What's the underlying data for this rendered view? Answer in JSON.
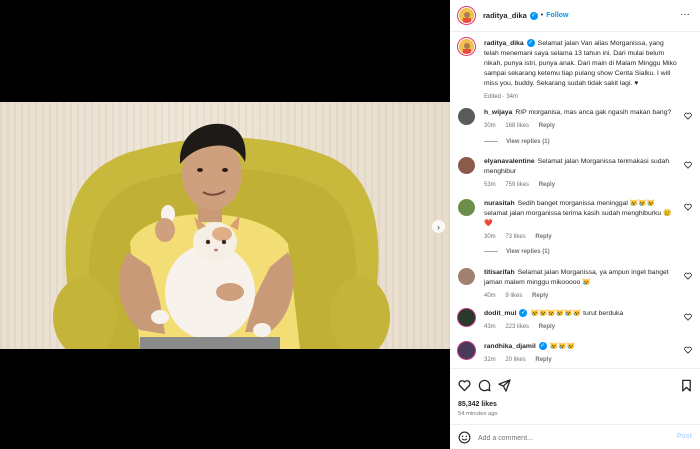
{
  "post": {
    "username": "raditya_dika",
    "follow_label": "Follow",
    "more_label": "···",
    "caption_text": "Selamat jalan Van alias Morganissa, yang telah menemani saya selama 13 tahun ini. Dari mulai belum nikah, punya istri, punya anak. Dari main di Malam Minggu Miko sampai sekarang ketemu tiap pulang show Cerita Sialku. I will miss you, buddy. Sekarang sudah tidak sakit lagi. ♥",
    "caption_edited": "Edited · 34m"
  },
  "comments": [
    {
      "user": "h_wijaya",
      "text": "RIP morganisa, mas anca gak ngasih makan bang?",
      "time": "30m",
      "likes": "168 likes",
      "reply": "Reply",
      "view_replies": "View replies (1)",
      "avatar_color": "#5a5a5a"
    },
    {
      "user": "elyanavalentine",
      "text": "Selamat jalan Morganissa terimakasi sudah menghibur",
      "time": "53m",
      "likes": "759 likes",
      "reply": "Reply",
      "avatar_color": "#8a5a4a"
    },
    {
      "user": "nurasitah",
      "text": "Sedih banget morganissa meninggal 😿😿😿 selamat jalan morganissa terima kasih sudah menghiburku 😢❤️",
      "time": "30m",
      "likes": "73 likes",
      "reply": "Reply",
      "view_replies": "View replies (1)",
      "avatar_color": "#6b8f4a"
    },
    {
      "user": "titisarifah",
      "text": "Selamat jalan Morganissa, ya ampun inget banget jaman malem minggu mikooooo 😿",
      "time": "40m",
      "likes": "9 likes",
      "reply": "Reply",
      "avatar_color": "#a08070"
    },
    {
      "user": "dodit_mul",
      "text": "😿😿😿😿😿😿 turut berduka",
      "time": "43m",
      "likes": "223 likes",
      "reply": "Reply",
      "avatar_color": "#2b3a2b",
      "verified": true
    },
    {
      "user": "randhika_djamil",
      "text": "😿😿😿",
      "time": "32m",
      "likes": "20 likes",
      "reply": "Reply",
      "avatar_color": "#4a3a5a",
      "verified": true
    }
  ],
  "engagement": {
    "likes_count": "85,342 likes",
    "posted_ago": "54 minutes ago"
  },
  "composer": {
    "placeholder": "Add a comment...",
    "post_label": "Post"
  },
  "colors": {
    "accent": "#0095f6",
    "chair": "#c9b83f",
    "shirt": "#f5df78"
  },
  "icons": [
    "next-arrow-icon",
    "more-icon",
    "verified-icon",
    "heart-icon",
    "comment-icon",
    "share-icon",
    "bookmark-icon",
    "emoji-icon"
  ]
}
